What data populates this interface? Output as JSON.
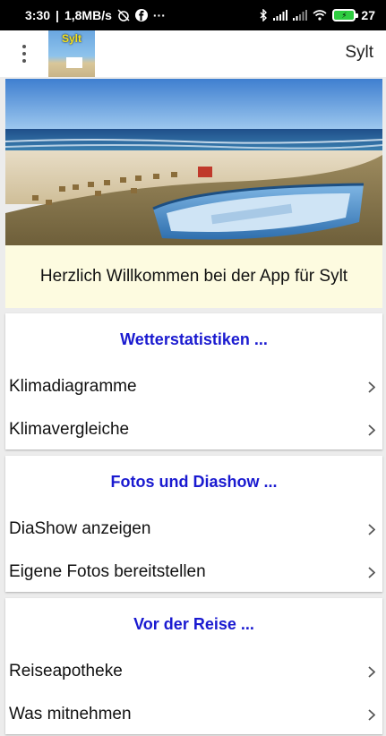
{
  "status_bar": {
    "time": "3:30",
    "net_speed": "1,8MB/s",
    "more": "···",
    "battery": "27"
  },
  "app_bar": {
    "logo_text": "Sylt",
    "title": "Sylt"
  },
  "welcome_text": "Herzlich Willkommen bei der App für Sylt",
  "sections": [
    {
      "title": "Wetterstatistiken ...",
      "items": [
        "Klimadiagramme",
        "Klimavergleiche"
      ]
    },
    {
      "title": "Fotos und Diashow ...",
      "items": [
        "DiaShow anzeigen",
        "Eigene Fotos bereitstellen"
      ]
    },
    {
      "title": "Vor der Reise ...",
      "items": [
        "Reiseapotheke",
        "Was mitnehmen"
      ]
    }
  ],
  "colors": {
    "section_title": "#1a1ad0",
    "welcome_bg": "#fdfbe0",
    "page_bg": "#ececec"
  },
  "icons": {
    "menu": "more-vert-icon",
    "chevron": "chevron-right-icon"
  }
}
